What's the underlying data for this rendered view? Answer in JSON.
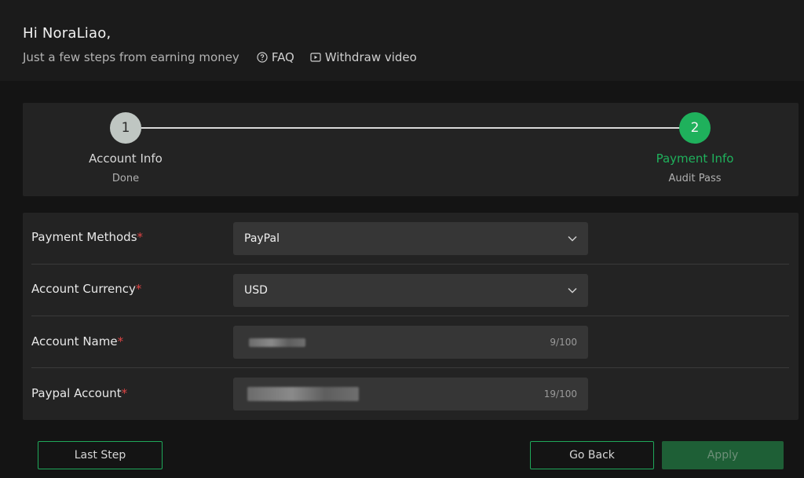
{
  "header": {
    "greeting": "Hi NoraLiao,",
    "tagline": "Just a few steps from earning money",
    "links": [
      {
        "label": "FAQ",
        "icon": "question-circle-icon"
      },
      {
        "label": "Withdraw video",
        "icon": "play-square-icon"
      }
    ]
  },
  "steps": [
    {
      "number": "1",
      "title": "Account Info",
      "status": "Done",
      "color": "#bfc6c2"
    },
    {
      "number": "2",
      "title": "Payment Info",
      "status": "Audit Pass",
      "color": "#1fb15c"
    }
  ],
  "form": {
    "payment_methods": {
      "label": "Payment Methods",
      "value": "PayPal"
    },
    "account_currency": {
      "label": "Account Currency",
      "value": "USD"
    },
    "account_name": {
      "label": "Account Name",
      "counter": "9/100"
    },
    "paypal_account": {
      "label": "Paypal Account",
      "counter": "19/100"
    },
    "required_mark": "*"
  },
  "buttons": {
    "last_step": "Last Step",
    "go_back": "Go Back",
    "apply": "Apply"
  },
  "colors": {
    "accent": "#1fb15c",
    "required": "#e04545"
  }
}
